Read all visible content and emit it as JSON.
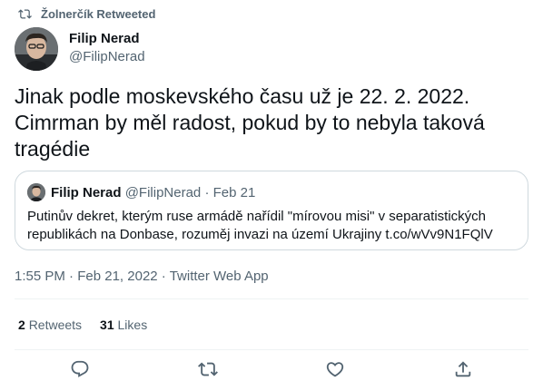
{
  "retweet": {
    "icon": "retweet-icon",
    "label": "Žolnerčík Retweeted"
  },
  "author": {
    "name": "Filip Nerad",
    "handle": "@FilipNerad",
    "avatar": "avatar"
  },
  "tweet": {
    "lines": [
      "Jinak podle moskevského času už je 22. 2. 2022.",
      "Cimrman by měl radost, pokud by to nebyla taková",
      "tragédie"
    ]
  },
  "quote": {
    "name": "Filip Nerad",
    "handle": "@FilipNerad",
    "separator": "·",
    "date": "Feb 21",
    "lines": [
      "Putinův dekret, kterým ruse armádě nařídil \"mírovou misi\" v separatistických",
      "republikách na Donbase, rozuměj invazi na území Ukrajiny t.co/wVv9N1FQlV"
    ]
  },
  "timestamp": {
    "time": "1:55 PM",
    "sep1": "·",
    "date": "Feb 21, 2022",
    "sep2": "·",
    "source": "Twitter Web App"
  },
  "stats": {
    "retweets_count": "2",
    "retweets_label": "Retweets",
    "likes_count": "31",
    "likes_label": "Likes"
  },
  "actions": [
    "reply-icon",
    "retweet-icon",
    "like-icon",
    "share-icon"
  ],
  "colors": {
    "text": "#0f1419",
    "secondary": "#536471",
    "border": "#cfd9de",
    "divider": "#eff3f4"
  }
}
